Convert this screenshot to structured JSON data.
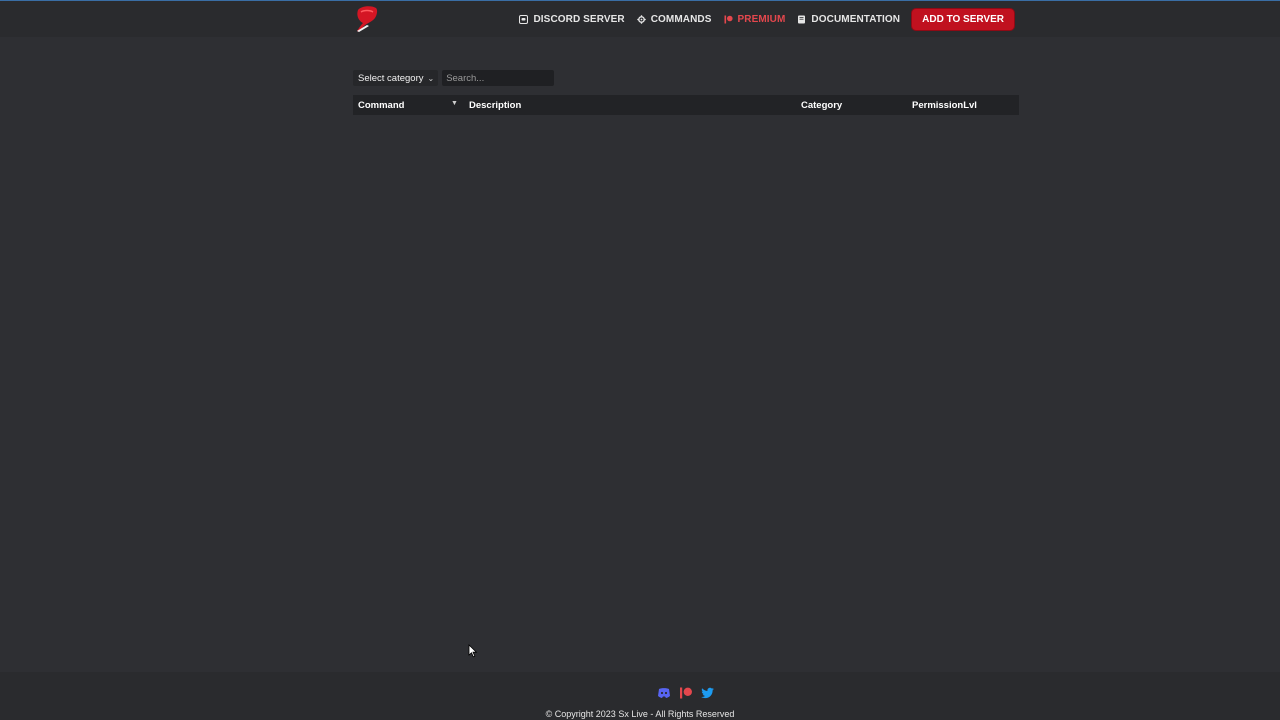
{
  "nav": {
    "items": [
      {
        "label": "DISCORD SERVER",
        "icon": "discord-box-icon"
      },
      {
        "label": "COMMANDS",
        "icon": "gear-icon"
      },
      {
        "label": "PREMIUM",
        "icon": "patreon-icon",
        "color": "#e4474d"
      },
      {
        "label": "DOCUMENTATION",
        "icon": "book-icon"
      }
    ],
    "add_button": "ADD TO SERVER",
    "accent_color": "#c0111f"
  },
  "filters": {
    "category_selected": "Select category",
    "search_placeholder": "Search..."
  },
  "table": {
    "columns": [
      "Command",
      "Description",
      "Category",
      "PermissionLvl"
    ]
  },
  "footer": {
    "social_icons": [
      "discord-icon",
      "patreon-icon",
      "twitter-icon"
    ],
    "copyright": "© Copyright 2023 Sx Live - All Rights Reserved"
  }
}
